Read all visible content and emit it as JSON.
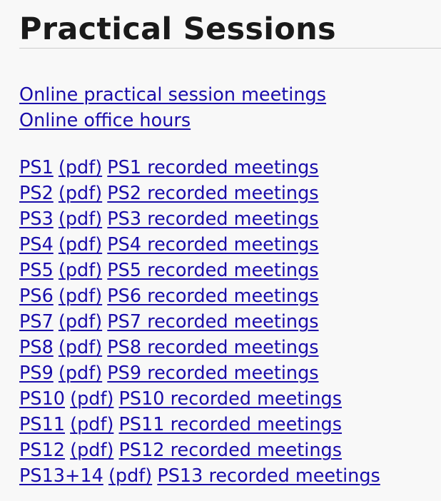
{
  "page": {
    "title": "Practical Sessions",
    "link_color": "#1a0dab"
  },
  "top_links": [
    {
      "label": "Online practical session meetings"
    },
    {
      "label": "Online office hours"
    }
  ],
  "sessions": [
    {
      "name": "PS1",
      "pdf": "(pdf)",
      "recorded": "PS1 recorded meetings"
    },
    {
      "name": "PS2",
      "pdf": "(pdf)",
      "recorded": "PS2 recorded meetings"
    },
    {
      "name": "PS3",
      "pdf": "(pdf)",
      "recorded": "PS3 recorded meetings"
    },
    {
      "name": "PS4",
      "pdf": "(pdf)",
      "recorded": "PS4 recorded meetings"
    },
    {
      "name": "PS5",
      "pdf": "(pdf)",
      "recorded": "PS5 recorded meetings"
    },
    {
      "name": "PS6",
      "pdf": "(pdf)",
      "recorded": "PS6 recorded meetings"
    },
    {
      "name": "PS7",
      "pdf": "(pdf)",
      "recorded": "PS7 recorded meetings"
    },
    {
      "name": "PS8",
      "pdf": "(pdf)",
      "recorded": "PS8 recorded meetings"
    },
    {
      "name": "PS9",
      "pdf": "(pdf)",
      "recorded": "PS9 recorded meetings"
    },
    {
      "name": "PS10",
      "pdf": "(pdf)",
      "recorded": "PS10 recorded meetings"
    },
    {
      "name": "PS11",
      "pdf": "(pdf)",
      "recorded": "PS11 recorded meetings"
    },
    {
      "name": "PS12",
      "pdf": "(pdf)",
      "recorded": "PS12 recorded meetings"
    },
    {
      "name": "PS13+14",
      "pdf": "(pdf)",
      "recorded": "PS13 recorded meetings"
    }
  ]
}
